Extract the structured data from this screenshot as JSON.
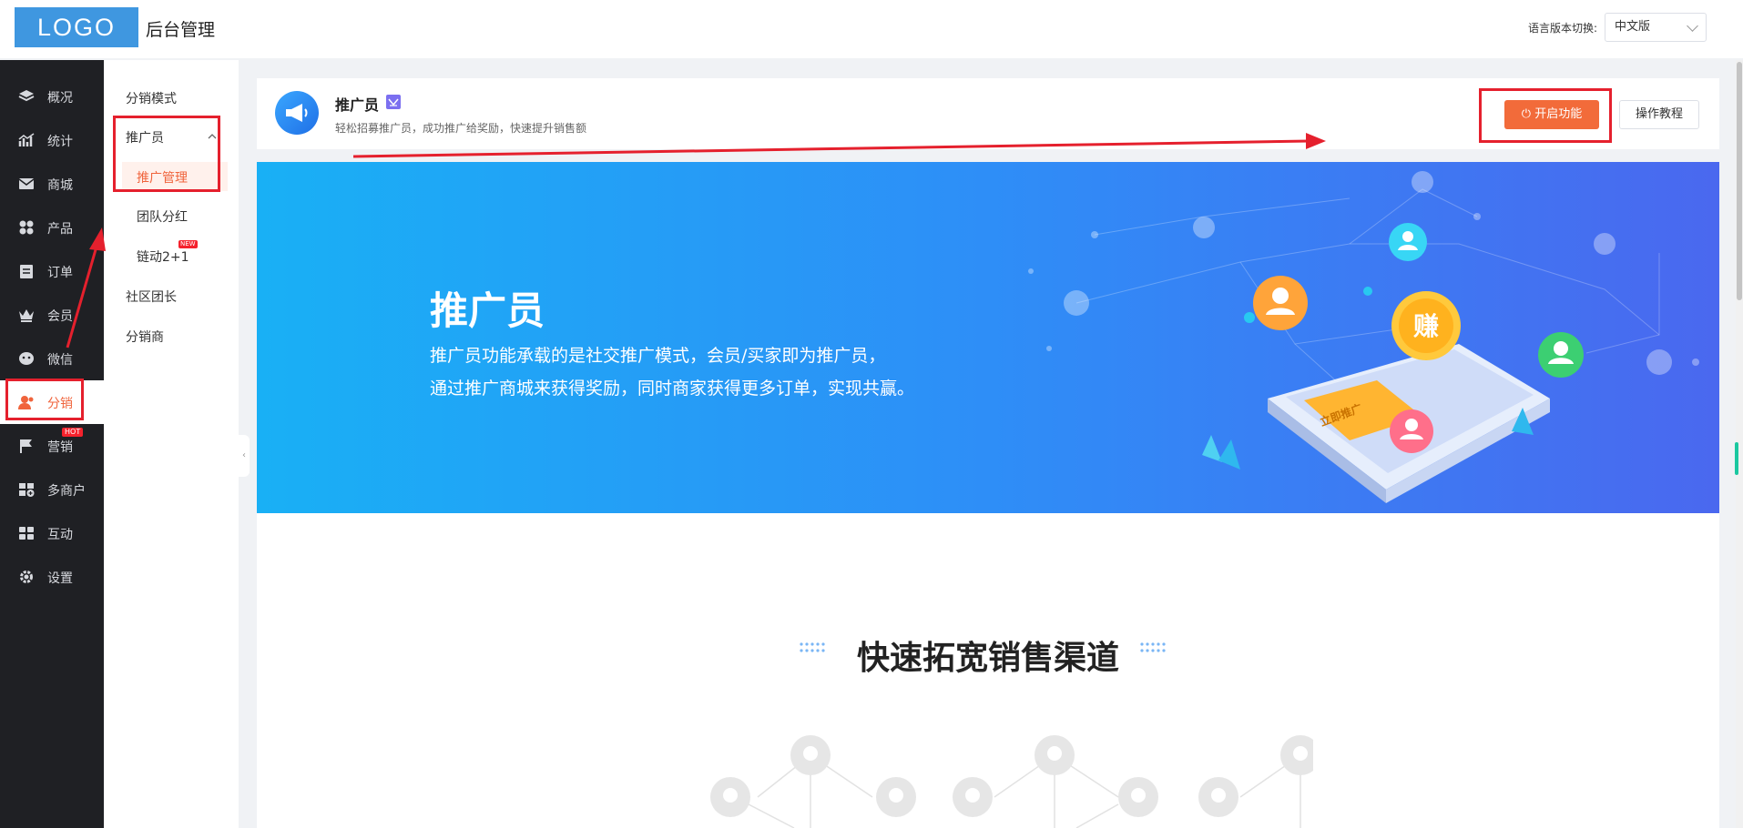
{
  "header": {
    "logo": "LOGO",
    "app_title": "后台管理",
    "language_label": "语言版本切换:",
    "language_value": "中文版"
  },
  "sidebar": {
    "items": [
      {
        "label": "概况",
        "icon": "layers-icon"
      },
      {
        "label": "统计",
        "icon": "chart-icon"
      },
      {
        "label": "商城",
        "icon": "mail-icon"
      },
      {
        "label": "产品",
        "icon": "grid-icon"
      },
      {
        "label": "订单",
        "icon": "clipboard-icon"
      },
      {
        "label": "会员",
        "icon": "crown-icon"
      },
      {
        "label": "微信",
        "icon": "wechat-icon"
      },
      {
        "label": "分销",
        "icon": "users-icon",
        "active": true
      },
      {
        "label": "营销",
        "icon": "flag-icon",
        "badge": "HOT"
      },
      {
        "label": "多商户",
        "icon": "store-add-icon"
      },
      {
        "label": "互动",
        "icon": "apps-icon"
      },
      {
        "label": "设置",
        "icon": "gear-icon"
      }
    ]
  },
  "submenu": {
    "mode": "分销模式",
    "promoter": "推广员",
    "promoter_mgmt": "推广管理",
    "team_dividend": "团队分红",
    "chain": "链动2+1",
    "chain_badge": "NEW",
    "community": "社区团长",
    "distributor": "分销商"
  },
  "card": {
    "title": "推广员",
    "desc": "轻松招募推广员，成功推广给奖励，快速提升销售额",
    "enable_button": "开启功能",
    "tutorial_button": "操作教程"
  },
  "banner": {
    "title": "推广员",
    "line1": "推广员功能承载的是社交推广模式，会员/买家即为推广员，",
    "line2": "通过推广商城来获得奖励，同时商家获得更多订单，实现共赢。",
    "coin_text": "赚",
    "phone_button_text": "立即推广"
  },
  "section": {
    "title": "快速拓宽销售渠道"
  },
  "colors": {
    "accent": "#f26b3a",
    "sidebar_bg": "#1f2024",
    "logo_bg": "#3f97e0",
    "annotation_red": "#e5202d"
  }
}
